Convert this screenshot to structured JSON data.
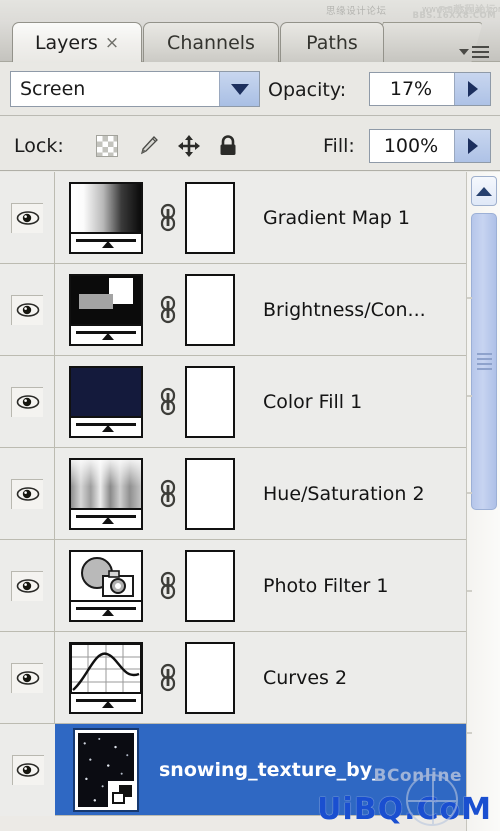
{
  "app": {
    "panel_title": "Layers"
  },
  "watermarks": {
    "top_cn": "思缘设计论坛",
    "top_url": "www.missyuan.com",
    "top_overlay1": "PS教程论坛",
    "top_overlay2": "BBS.16XX8.COM",
    "bottom_main": "UiBQ.CoM",
    "bottom_sub": "BConline"
  },
  "tabs": [
    {
      "label": "Layers",
      "active": true,
      "closable": true,
      "close_glyph": "×"
    },
    {
      "label": "Channels",
      "active": false,
      "closable": false,
      "close_glyph": ""
    },
    {
      "label": "Paths",
      "active": false,
      "closable": false,
      "close_glyph": ""
    }
  ],
  "panel_menu": {
    "name": "panel-menu-button"
  },
  "blend": {
    "mode_value": "Screen",
    "opacity_label": "Opacity:",
    "opacity_value": "17%"
  },
  "lock": {
    "label": "Lock:",
    "items": [
      {
        "name": "lock-transparent-pixels",
        "icon": "checkerboard-icon"
      },
      {
        "name": "lock-image-pixels",
        "icon": "paintbrush-icon"
      },
      {
        "name": "lock-position",
        "icon": "move-arrows-icon"
      },
      {
        "name": "lock-all",
        "icon": "padlock-icon"
      }
    ],
    "fill_label": "Fill:",
    "fill_value": "100%"
  },
  "layers": [
    {
      "name": "Gradient Map 1",
      "kind": "gradient-map",
      "visible": true,
      "linked": true,
      "has_mask": true,
      "selected": false
    },
    {
      "name": "Brightness/Con...",
      "kind": "brightness-contrast",
      "visible": true,
      "linked": true,
      "has_mask": true,
      "selected": false
    },
    {
      "name": "Color Fill 1",
      "kind": "solid-color",
      "visible": true,
      "linked": true,
      "has_mask": true,
      "selected": false,
      "color": "#141a3c"
    },
    {
      "name": "Hue/Saturation 2",
      "kind": "hue-saturation",
      "visible": true,
      "linked": true,
      "has_mask": true,
      "selected": false
    },
    {
      "name": "Photo Filter 1",
      "kind": "photo-filter",
      "visible": true,
      "linked": true,
      "has_mask": true,
      "selected": false
    },
    {
      "name": "Curves 2",
      "kind": "curves",
      "visible": true,
      "linked": true,
      "has_mask": true,
      "selected": false
    },
    {
      "name": "snowing_texture_by_",
      "kind": "smart-object",
      "visible": true,
      "linked": false,
      "has_mask": false,
      "selected": true
    }
  ],
  "scrollbar": {
    "up_arrow": "scroll-up-arrow",
    "thumb": "scroll-thumb"
  },
  "colors": {
    "selection_blue": "#2f68c3",
    "panel_bg": "#e9e8e4",
    "row_bg": "#ececea",
    "accent_button": "#aec2e6",
    "watermark_blue": "#1a4fd0"
  }
}
